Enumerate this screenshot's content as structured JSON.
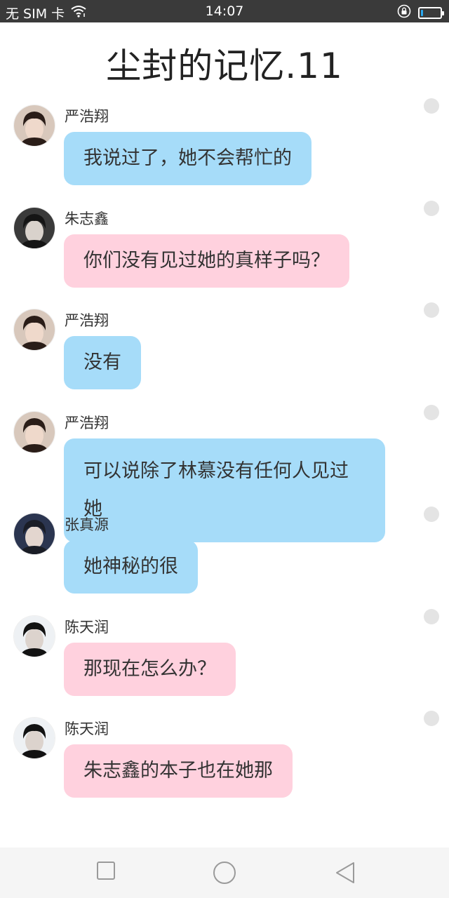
{
  "status_bar": {
    "carrier": "无 SIM 卡",
    "time": "14:07",
    "battery_level": 0.1,
    "icons": [
      "wifi-icon",
      "lock-rotation-icon",
      "battery-icon"
    ]
  },
  "title": "尘封的记忆.11",
  "colors": {
    "blue_bubble": "#a6dcf9",
    "pink_bubble": "#ffd1de",
    "status_bar": "#3a3a3a"
  },
  "messages": [
    {
      "sender": "严浩翔",
      "text": "我说过了，她不会帮忙的",
      "color": "blue"
    },
    {
      "sender": "朱志鑫",
      "text": "你们没有见过她的真样子吗？",
      "color": "pink"
    },
    {
      "sender": "严浩翔",
      "text": "没有",
      "color": "blue"
    },
    {
      "sender": "严浩翔",
      "text": "可以说除了林慕没有任何人见过她",
      "color": "blue"
    },
    {
      "sender": "张真源",
      "text": "她神秘的很",
      "color": "blue"
    },
    {
      "sender": "陈天润",
      "text": "那现在怎么办？",
      "color": "pink"
    },
    {
      "sender": "陈天润",
      "text": "朱志鑫的本子也在她那",
      "color": "pink"
    }
  ],
  "nav_bar": {
    "icons": [
      "recent-apps-icon",
      "home-icon",
      "back-icon"
    ]
  }
}
